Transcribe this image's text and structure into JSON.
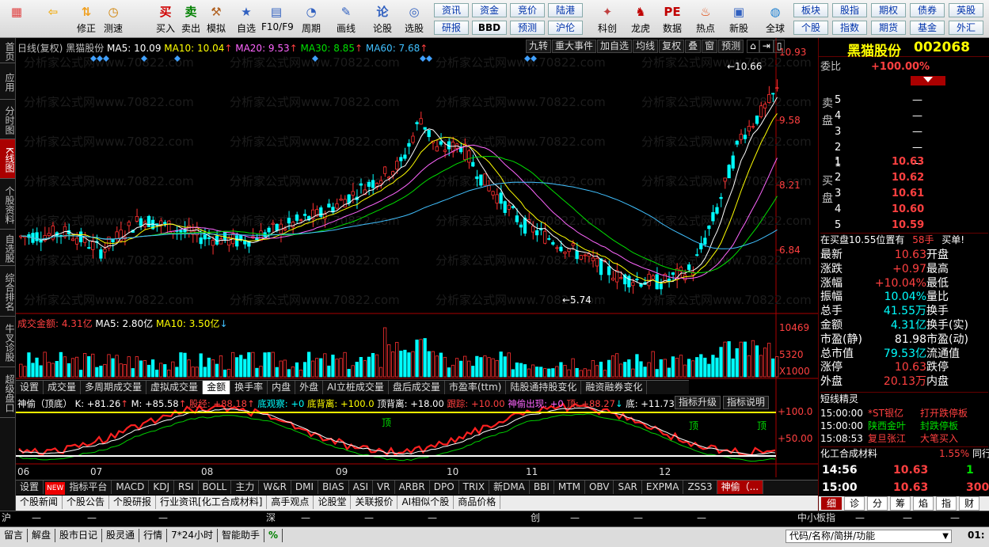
{
  "toolbar": {
    "buttons": [
      {
        "label": "",
        "icon": "windows-logo-icon"
      },
      {
        "label": "",
        "icon": "back-arrow-icon"
      },
      {
        "label": "修正",
        "icon": "up-down-arrows-icon"
      },
      {
        "label": "测速",
        "icon": "clock-icon"
      },
      {
        "label": "买入",
        "icon": "buy-icon",
        "glyph": "买"
      },
      {
        "label": "卖出",
        "icon": "sell-icon",
        "glyph": "卖"
      },
      {
        "label": "模拟",
        "icon": "hammer-icon"
      },
      {
        "label": "自选",
        "icon": "star-icon"
      },
      {
        "label": "F10/F9",
        "icon": "f10-icon"
      },
      {
        "label": "周期",
        "icon": "period-icon"
      },
      {
        "label": "画线",
        "icon": "pencil-icon"
      },
      {
        "label": "论股",
        "icon": "discuss-icon",
        "glyph": "论"
      },
      {
        "label": "选股",
        "icon": "magnifier-chart-icon"
      },
      {
        "label": "科创",
        "icon": "star-market-icon"
      },
      {
        "label": "龙虎",
        "icon": "dragon-tiger-icon"
      },
      {
        "label": "数据",
        "icon": "pe-icon",
        "glyph": "PE"
      },
      {
        "label": "热点",
        "icon": "fire-icon"
      },
      {
        "label": "新股",
        "icon": "ipo-icon"
      },
      {
        "label": "全球",
        "icon": "globe-icon"
      }
    ],
    "quick_row1": [
      "资讯",
      "资金",
      "竞价",
      "陆港"
    ],
    "quick_row2": [
      "研报",
      "BBD",
      "预测",
      "沪伦"
    ],
    "quick_right_row1": [
      "板块",
      "股指",
      "期权",
      "债券",
      "英股"
    ],
    "quick_right_row2": [
      "个股",
      "指数",
      "期货",
      "基金",
      "外汇"
    ]
  },
  "left_tabs": [
    "首页",
    "应用",
    "分时图",
    "K线图",
    "个股资料",
    "自选股",
    "综合排名",
    "牛叉诊股",
    "超级盘口"
  ],
  "chart": {
    "header": {
      "period": "日线(复权)",
      "name": "黑猫股份",
      "ma5": "MA5: 10.09",
      "ma10": "MA10: 10.04",
      "ma20": "MA20: 9.53",
      "ma30": "MA30: 8.85",
      "ma60": "MA60: 7.68"
    },
    "header_buttons": [
      "九转",
      "重大事件",
      "加自选",
      "均线",
      "复权",
      "叠",
      "窗",
      "预测"
    ],
    "y_labels": [
      "10.93",
      "9.58",
      "8.21",
      "6.84"
    ],
    "high_label": "10.66",
    "low_label": "5.74",
    "x_labels": [
      "06",
      "07",
      "08",
      "09",
      "10",
      "11",
      "12"
    ],
    "volume_header": {
      "title": "成交金额: 4.31亿",
      "ma5": "MA5: 2.80亿",
      "ma10": "MA10: 3.50亿"
    },
    "volume_y_labels": [
      "10469",
      "5320",
      "X1000"
    ],
    "sub_tabs": [
      "设置",
      "成交量",
      "多周期成交量",
      "虚拟成交量",
      "金额",
      "换手率",
      "内盘",
      "外盘",
      "AI立桩成交量",
      "盘后成交量",
      "市盈率(ttm)",
      "陆股通持股变化",
      "融资融券变化"
    ],
    "indicator_header": {
      "name": "神偷（顶底）",
      "k": "K: +81.26",
      "m": "M: +85.58",
      "gujing": "股经: +88.18",
      "didian": "底观察: +0",
      "dibeili": "底背离: +100.0",
      "dingbeili": "顶背离: +18.00",
      "genzong": "跟踪: +10.00",
      "shentou": "神偷出现: +0",
      "ding": "顶: +88.27",
      "di": "底: +11.73"
    },
    "indicator_buttons": [
      "指标升级",
      "指标说明"
    ],
    "indicator_y_labels": [
      "+100.0",
      "+50.00"
    ],
    "indicator_marks": [
      "顶",
      "顶",
      "顶"
    ],
    "indicator_tabs": [
      "设置",
      "指标平台",
      "MACD",
      "KDJ",
      "RSI",
      "BOLL",
      "主力",
      "W&R",
      "DMI",
      "BIAS",
      "ASI",
      "VR",
      "ARBR",
      "DPO",
      "TRIX",
      "新DMA",
      "BBI",
      "MTM",
      "OBV",
      "SAR",
      "EXPMA",
      "ZSS3",
      "神偷（..."
    ],
    "new_badge": "NEW",
    "watermark": "分析家公式网www.70822.com"
  },
  "news_tabs": [
    "个股新闻",
    "个股公告",
    "个股研报",
    "行业资讯[化工合成材料]",
    "高手观点",
    "论股堂",
    "关联报价",
    "AI相似个股",
    "商品价格"
  ],
  "right_panel": {
    "title": "黑猫股份",
    "code": "002068",
    "weibi_label": "委比",
    "weibi_value": "+100.00%",
    "sell_label": "卖盘",
    "buy_label": "买盘",
    "sell_rows": [
      {
        "level": "5",
        "price": "—"
      },
      {
        "level": "4",
        "price": "—"
      },
      {
        "level": "3",
        "price": "—"
      },
      {
        "level": "2",
        "price": "—"
      },
      {
        "level": "1",
        "price": "—"
      }
    ],
    "buy_rows": [
      {
        "level": "1",
        "price": "10.63"
      },
      {
        "level": "2",
        "price": "10.62"
      },
      {
        "level": "3",
        "price": "10.61"
      },
      {
        "level": "4",
        "price": "10.60"
      },
      {
        "level": "5",
        "price": "10.59"
      }
    ],
    "notice": "在买盘10.55位置有",
    "notice_qty": "58手",
    "notice_action": "买单!",
    "quotes": [
      {
        "l1": "最新",
        "v1": "10.63",
        "c1": "red",
        "l2": "开盘",
        "v2": ""
      },
      {
        "l1": "涨跌",
        "v1": "+0.97",
        "c1": "red",
        "l2": "最高",
        "v2": ""
      },
      {
        "l1": "涨幅",
        "v1": "+10.04%",
        "c1": "red",
        "l2": "最低",
        "v2": ""
      },
      {
        "l1": "振幅",
        "v1": "10.04%",
        "c1": "cyan",
        "l2": "量比",
        "v2": ""
      },
      {
        "l1": "总手",
        "v1": "41.55万",
        "c1": "cyan",
        "l2": "换手",
        "v2": ""
      },
      {
        "l1": "金额",
        "v1": "4.31亿",
        "c1": "cyan",
        "l2": "换手(实)",
        "v2": ""
      },
      {
        "l1": "市盈(静)",
        "v1": "81.98",
        "c1": "white",
        "l2": "市盈(动)",
        "v2": ""
      },
      {
        "l1": "总市值",
        "v1": "79.53亿",
        "c1": "cyan",
        "l2": "流通值",
        "v2": ""
      },
      {
        "l1": "涨停",
        "v1": "10.63",
        "c1": "red",
        "l2": "跌停",
        "v2": ""
      },
      {
        "l1": "外盘",
        "v1": "20.13万",
        "c1": "red",
        "l2": "内盘",
        "v2": ""
      }
    ],
    "short_title": "短线精灵",
    "short_rows": [
      {
        "time": "15:00:00",
        "name": "*ST银亿",
        "event": "打开跌停板",
        "color": "red"
      },
      {
        "time": "15:00:00",
        "name": "陕西金叶",
        "event": "封跌停板",
        "color": "green"
      },
      {
        "time": "15:08:53",
        "name": "复旦张江",
        "event": "大笔买入",
        "color": "red"
      }
    ],
    "industry": "化工合成材料",
    "industry_pct": "1.55%",
    "industry_more": "同行",
    "ticks": [
      {
        "time": "14:56",
        "price": "10.63",
        "vol": "1"
      },
      {
        "time": "15:00",
        "price": "10.63",
        "vol": "300"
      }
    ],
    "bottom_tabs": [
      "细",
      "诊",
      "分",
      "筹",
      "焰",
      "指",
      "财"
    ]
  },
  "status": {
    "sh": "沪",
    "sz": "深",
    "cy": "创",
    "zx": "中小板指",
    "items": [
      "留言",
      "解盘",
      "股市日记",
      "股灵通",
      "行情",
      "7*24小时",
      "智能助手",
      "%"
    ],
    "search_placeholder": "代码/名称/简拼/功能",
    "time": "01:"
  }
}
